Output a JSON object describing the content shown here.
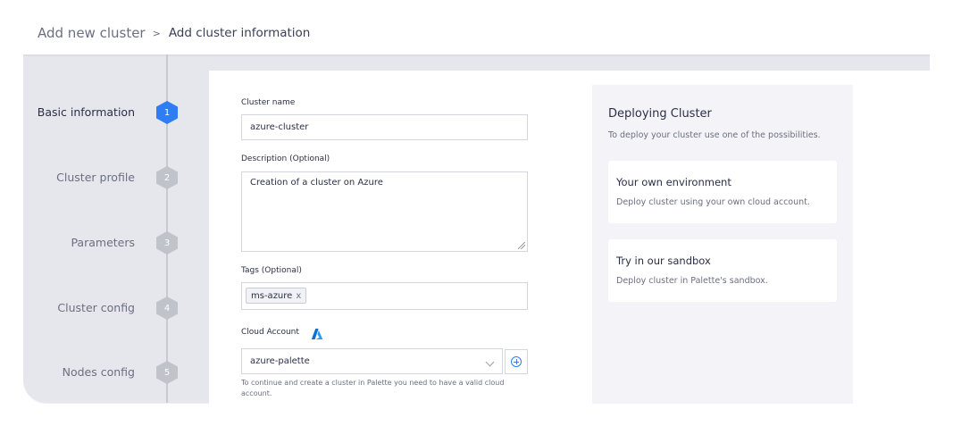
{
  "breadcrumb": {
    "parent": "Add new cluster",
    "separator": ">",
    "current": "Add cluster information"
  },
  "steps": [
    {
      "label": "Basic information",
      "number": "1",
      "active": true
    },
    {
      "label": "Cluster profile",
      "number": "2",
      "active": false
    },
    {
      "label": "Parameters",
      "number": "3",
      "active": false
    },
    {
      "label": "Cluster config",
      "number": "4",
      "active": false
    },
    {
      "label": "Nodes config",
      "number": "5",
      "active": false
    }
  ],
  "form": {
    "cluster_name": {
      "label": "Cluster name",
      "value": "azure-cluster"
    },
    "description": {
      "label": "Description (Optional)",
      "value": "Creation of a cluster on Azure"
    },
    "tags": {
      "label": "Tags (Optional)",
      "items": [
        {
          "text": "ms-azure",
          "remove": "x"
        }
      ]
    },
    "cloud_account": {
      "label": "Cloud Account",
      "icon": "azure-logo-icon",
      "value": "azure-palette",
      "helper": "To continue and create a cluster in Palette you need to have a valid cloud account."
    }
  },
  "info_panel": {
    "title": "Deploying Cluster",
    "subtitle": "To deploy your cluster use one of the possibilities.",
    "options": [
      {
        "title": "Your own environment",
        "description": "Deploy cluster using your own cloud account."
      },
      {
        "title": "Try in our sandbox",
        "description": "Deploy cluster in Palette's sandbox."
      }
    ]
  },
  "colors": {
    "accent": "#2e7df5",
    "step_inactive": "#c1c3cb",
    "sidebar_bg": "#e6e7ec",
    "info_bg": "#f4f4f8"
  }
}
